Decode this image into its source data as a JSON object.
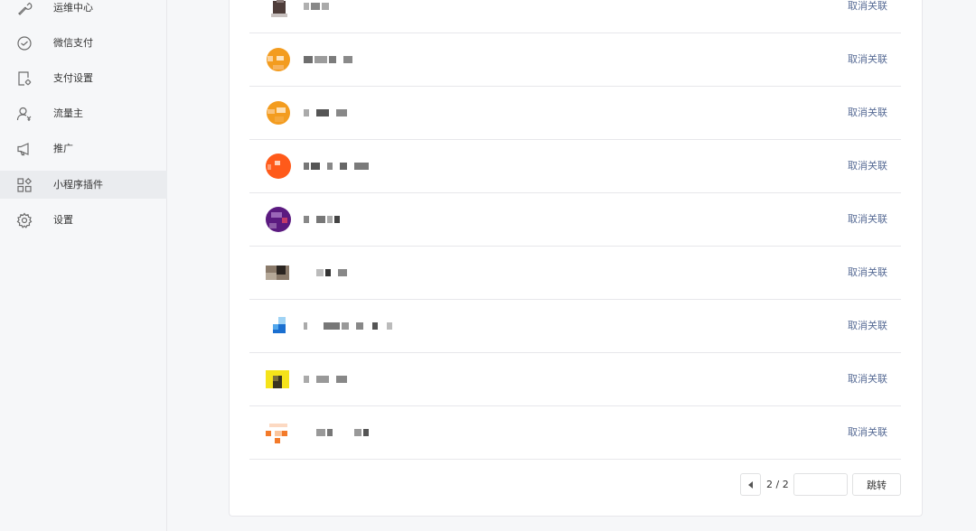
{
  "sidebar": {
    "items": [
      {
        "label": "运维中心",
        "icon": "wrench-icon",
        "active": false
      },
      {
        "label": "微信支付",
        "icon": "wechat-pay-icon",
        "active": false
      },
      {
        "label": "支付设置",
        "icon": "payment-settings-icon",
        "active": false
      },
      {
        "label": "流量主",
        "icon": "traffic-owner-icon",
        "active": false
      },
      {
        "label": "推广",
        "icon": "megaphone-icon",
        "active": false
      },
      {
        "label": "小程序插件",
        "icon": "plugin-grid-icon",
        "active": true
      },
      {
        "label": "设置",
        "icon": "gear-icon",
        "active": false
      }
    ]
  },
  "plugins": {
    "action_label": "取消关联",
    "rows": [
      {
        "avatar_color": "#5b4a48"
      },
      {
        "avatar_color": "#f39c1f"
      },
      {
        "avatar_color": "#f39c1f"
      },
      {
        "avatar_color": "#ff5a1a"
      },
      {
        "avatar_color": "#5b1a80"
      },
      {
        "avatar_color": "#4a4038"
      },
      {
        "avatar_color": "#2a7fd4"
      },
      {
        "avatar_color": "#f5e31a"
      },
      {
        "avatar_color": "#f37a2a"
      }
    ]
  },
  "pagination": {
    "info": "2 / 2",
    "input_value": "",
    "go_label": "跳转"
  },
  "colors": {
    "link": "#576b95",
    "border": "#e7e7eb",
    "sidebar_bg": "#f6f7f9",
    "active_bg": "#eaecef"
  }
}
